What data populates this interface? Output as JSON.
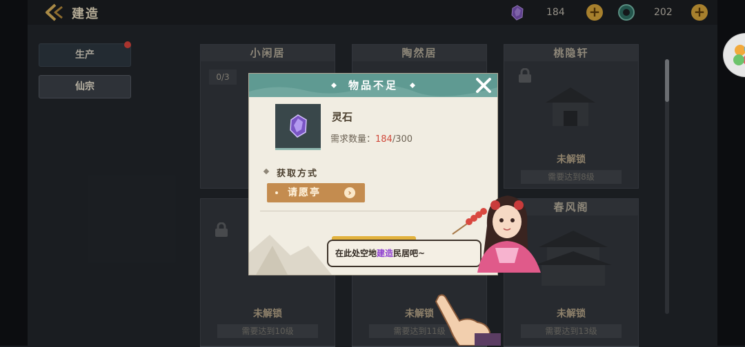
{
  "topbar": {
    "title": "建造",
    "resources": [
      {
        "icon": "spirit-stone-icon",
        "value": "184"
      },
      {
        "icon": "jade-coin-icon",
        "value": "202"
      }
    ]
  },
  "sidebar": {
    "tabs": [
      {
        "label": "生产",
        "has_red_dot": true
      },
      {
        "label": "仙宗"
      }
    ]
  },
  "cards": [
    {
      "name": "小闲居",
      "count": "0/3"
    },
    {
      "name": "陶然居"
    },
    {
      "name": "桃隐轩",
      "status": "未解锁",
      "req": "需要达到8级"
    },
    {
      "name": "春风阁",
      "status": "未解锁",
      "req": "需要达到13级"
    },
    {
      "status": "未解锁",
      "req": "需要达到10级"
    },
    {
      "status": "未解锁",
      "req": "需要达到11级"
    },
    {
      "status": "未解锁",
      "req": "需要达到13级"
    }
  ],
  "dialog": {
    "title": "物品不足",
    "item_name": "灵石",
    "req_label": "需求数量：",
    "req_have": "184",
    "req_need": "/300",
    "source_title": "获取方式",
    "source_button": "请愿亭"
  },
  "tutorial": {
    "text_a": "在此处空地",
    "text_hl": "建造",
    "text_b": "民居吧~"
  },
  "colors": {
    "dialog_header": "#5f9a92",
    "accent_gold": "#d7a43a",
    "warning_red": "#d0493b",
    "source_button": "#c48c4f",
    "highlight_purple": "#8e3fd0"
  }
}
